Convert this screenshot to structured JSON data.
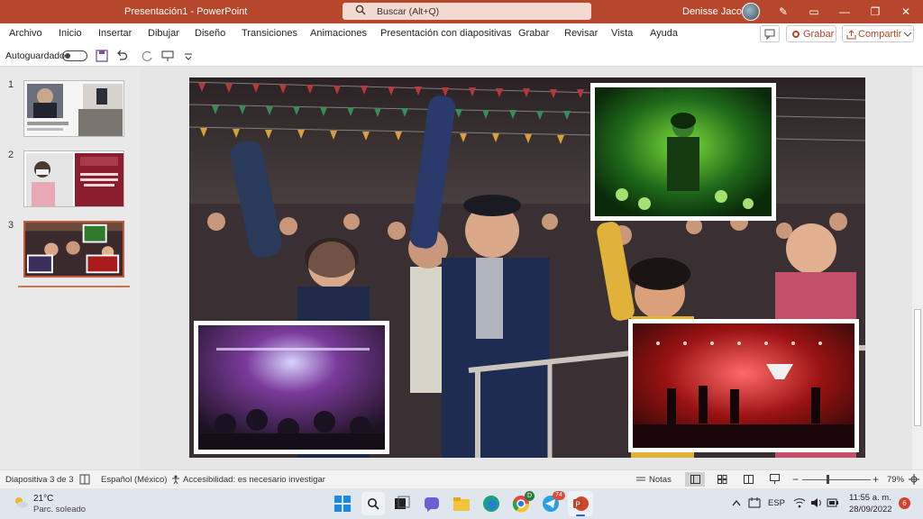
{
  "window": {
    "doc_title": "Presentación1 - PowerPoint",
    "search_placeholder": "Buscar (Alt+Q)",
    "user_name": "Denisse Jacobo"
  },
  "ribbon": {
    "tabs": [
      "Archivo",
      "Inicio",
      "Insertar",
      "Dibujar",
      "Diseño",
      "Transiciones",
      "Animaciones",
      "Presentación con diapositivas",
      "Grabar",
      "Revisar",
      "Vista",
      "Ayuda"
    ],
    "record_label": "Grabar",
    "share_label": "Compartir"
  },
  "quick_access": {
    "autosave_label": "Autoguardado"
  },
  "thumbnails": [
    {
      "number": "1"
    },
    {
      "number": "2"
    },
    {
      "number": "3",
      "selected": true
    }
  ],
  "status": {
    "slide_info": "Diapositiva 3 de 3",
    "language": "Español (México)",
    "accessibility": "Accesibilidad: es necesario investigar",
    "notes_label": "Notas",
    "zoom": "79%"
  },
  "taskbar": {
    "weather_temp": "21°C",
    "weather_desc": "Parc. soleado",
    "language": "ESP",
    "time": "11:55 a. m.",
    "date": "28/09/2022",
    "notification_count": "6",
    "chrome_badge": "D",
    "telegram_badge": "74"
  },
  "colors": {
    "accent": "#b7472a",
    "selection": "#c55a3a"
  }
}
